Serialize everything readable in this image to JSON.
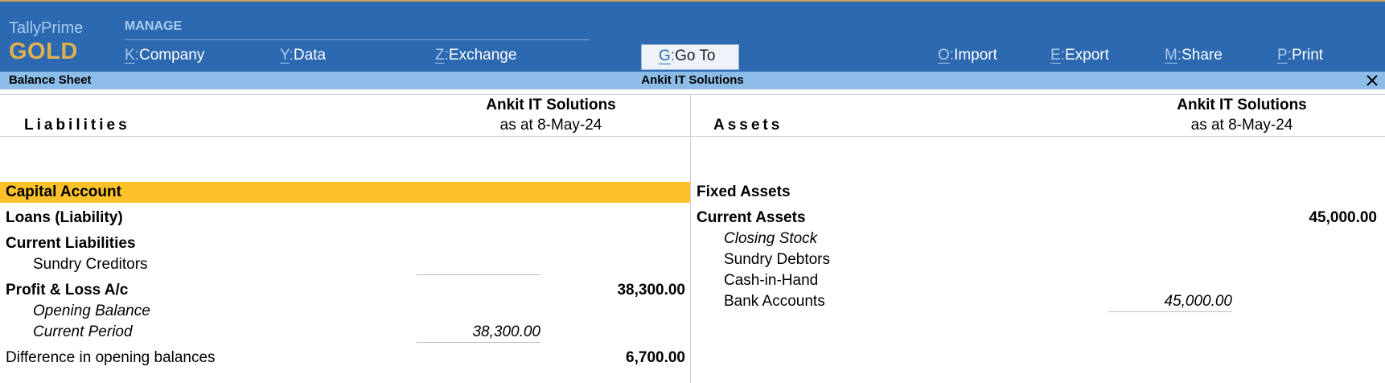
{
  "brand": {
    "name": "TallyPrime",
    "edition": "GOLD"
  },
  "menu": {
    "manage_label": "MANAGE",
    "items": [
      {
        "key": "K",
        "label": "Company"
      },
      {
        "key": "Y",
        "label": "Data"
      },
      {
        "key": "Z",
        "label": "Exchange"
      },
      {
        "key": "G",
        "label": "Go To"
      },
      {
        "key": "O",
        "label": "Import"
      },
      {
        "key": "E",
        "label": "Export"
      },
      {
        "key": "M",
        "label": "Share"
      },
      {
        "key": "P",
        "label": "Print"
      }
    ]
  },
  "titlebar": {
    "report": "Balance Sheet",
    "company": "Ankit IT Solutions",
    "close_icon": "close-icon"
  },
  "liabilities": {
    "heading": "Liabilities",
    "company": "Ankit IT Solutions",
    "as_at": "as at 8-May-24",
    "rows": [
      {
        "label": "Capital Account",
        "amount": "",
        "sub_amount": ""
      },
      {
        "label": "Loans (Liability)",
        "amount": "",
        "sub_amount": ""
      },
      {
        "label": "Current Liabilities",
        "amount": "",
        "sub_amount": ""
      },
      {
        "label": "Sundry Creditors",
        "amount": "",
        "sub_amount": ""
      },
      {
        "label": "Profit & Loss A/c",
        "amount": "38,300.00",
        "sub_amount": ""
      },
      {
        "label": "Opening Balance",
        "amount": "",
        "sub_amount": ""
      },
      {
        "label": "Current Period",
        "amount": "",
        "sub_amount": "38,300.00"
      },
      {
        "label": "Difference in opening balances",
        "amount": "6,700.00",
        "sub_amount": ""
      }
    ]
  },
  "assets": {
    "heading": "Assets",
    "company": "Ankit IT Solutions",
    "as_at": "as at 8-May-24",
    "rows": [
      {
        "label": "Fixed Assets",
        "amount": "",
        "sub_amount": ""
      },
      {
        "label": "Current Assets",
        "amount": "45,000.00",
        "sub_amount": ""
      },
      {
        "label": "Closing Stock",
        "amount": "",
        "sub_amount": ""
      },
      {
        "label": "Sundry Debtors",
        "amount": "",
        "sub_amount": ""
      },
      {
        "label": "Cash-in-Hand",
        "amount": "",
        "sub_amount": ""
      },
      {
        "label": "Bank Accounts",
        "amount": "",
        "sub_amount": "45,000.00"
      }
    ]
  },
  "colors": {
    "menu_bg": "#2c69b0",
    "title_bg": "#8cbde8",
    "highlight": "#fdc12a",
    "brand_gold": "#e0b050"
  }
}
